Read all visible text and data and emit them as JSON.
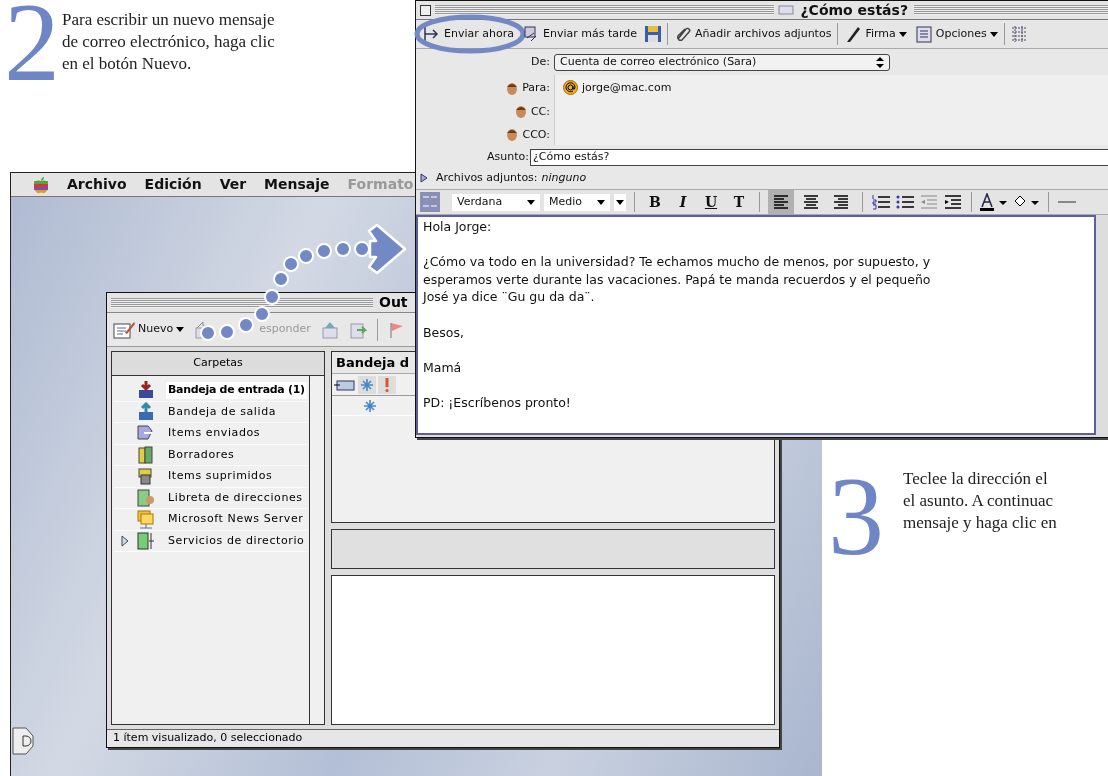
{
  "instructions": [
    {
      "number": "2",
      "text": "Para escribir un nuevo mensaje\nde correo electrónico, haga clic\nen el botón Nuevo."
    },
    {
      "number": "3",
      "text": "Teclee la dirección el\nel asunto. A continuac\nmensaje y haga clic en"
    }
  ],
  "menu_bar": {
    "items": [
      {
        "label": "Archivo",
        "disabled": false
      },
      {
        "label": "Edición",
        "disabled": false
      },
      {
        "label": "Ver",
        "disabled": false
      },
      {
        "label": "Mensaje",
        "disabled": false
      },
      {
        "label": "Formato",
        "disabled": true
      }
    ]
  },
  "main_window": {
    "title": "Out",
    "toolbar": [
      {
        "label": "Nuevo",
        "dropdown": true,
        "disabled": false
      },
      {
        "label": "esponder",
        "dropdown": false,
        "disabled": true
      }
    ],
    "folders_header": "Carpetas",
    "folders": [
      {
        "label": "Bandeja de entrada (1)",
        "unread": true,
        "selected": true,
        "expandable": false
      },
      {
        "label": "Bandeja de salida",
        "unread": false,
        "selected": false,
        "expandable": false
      },
      {
        "label": "Items enviados",
        "unread": false,
        "selected": false,
        "expandable": false
      },
      {
        "label": "Borradores",
        "unread": false,
        "selected": false,
        "expandable": false
      },
      {
        "label": "Items suprimidos",
        "unread": false,
        "selected": false,
        "expandable": false
      },
      {
        "label": "Libreta de direcciones",
        "unread": false,
        "selected": false,
        "expandable": false
      },
      {
        "label": "Microsoft News Server",
        "unread": false,
        "selected": false,
        "expandable": false
      },
      {
        "label": "Servicios de directorio",
        "unread": false,
        "selected": false,
        "expandable": true
      }
    ],
    "list_title": "Bandeja d",
    "status_bar": "1 ítem visualizado, 0 seleccionado"
  },
  "compose_window": {
    "title": "¿Cómo estás?",
    "toolbar_groups": [
      [
        {
          "kind": "button",
          "label": "Enviar ahora",
          "dropdown": false,
          "highlighted": true
        },
        {
          "kind": "button",
          "label": "Enviar más tarde",
          "dropdown": false,
          "highlighted": false
        },
        {
          "kind": "icon"
        }
      ],
      [
        {
          "kind": "button",
          "label": "Añadir archivos adjuntos",
          "dropdown": false,
          "highlighted": false
        }
      ],
      [
        {
          "kind": "button",
          "label": "Firma",
          "dropdown": true,
          "highlighted": false
        },
        {
          "kind": "button",
          "label": "Opciones",
          "dropdown": true,
          "highlighted": false
        }
      ],
      [
        {
          "kind": "icon"
        }
      ]
    ],
    "from_label": "De:",
    "from_value": "Cuenta de correo electrónico (Sara)",
    "recipients": [
      {
        "label": "Para:",
        "value": "jorge@mac.com"
      },
      {
        "label": "CC:"
      },
      {
        "label": "CCO:"
      }
    ],
    "subject_label": "Asunto:",
    "subject": "¿Cómo estás?",
    "attachments_label": "Archivos adjuntos:",
    "attachments_value": "ninguno",
    "format_bar": {
      "font": "Verdana",
      "size": "Medio",
      "styles": [
        "B",
        "I",
        "U",
        "T"
      ],
      "alignments": [
        {
          "selected": true
        },
        {
          "selected": false
        },
        {
          "selected": false
        }
      ]
    },
    "body": "Hola Jorge:\n\n¿Cómo va todo en la universidad? Te echamos mucho de menos, por supuesto, y\nesperamos verte durante las vacaciones. Papá te manda recuerdos y el pequeño\nJosé ya dice ¨Gu gu da da¨.\n\nBesos,\n\nMamá\n\nPD: ¡Escríbenos pronto!"
  }
}
